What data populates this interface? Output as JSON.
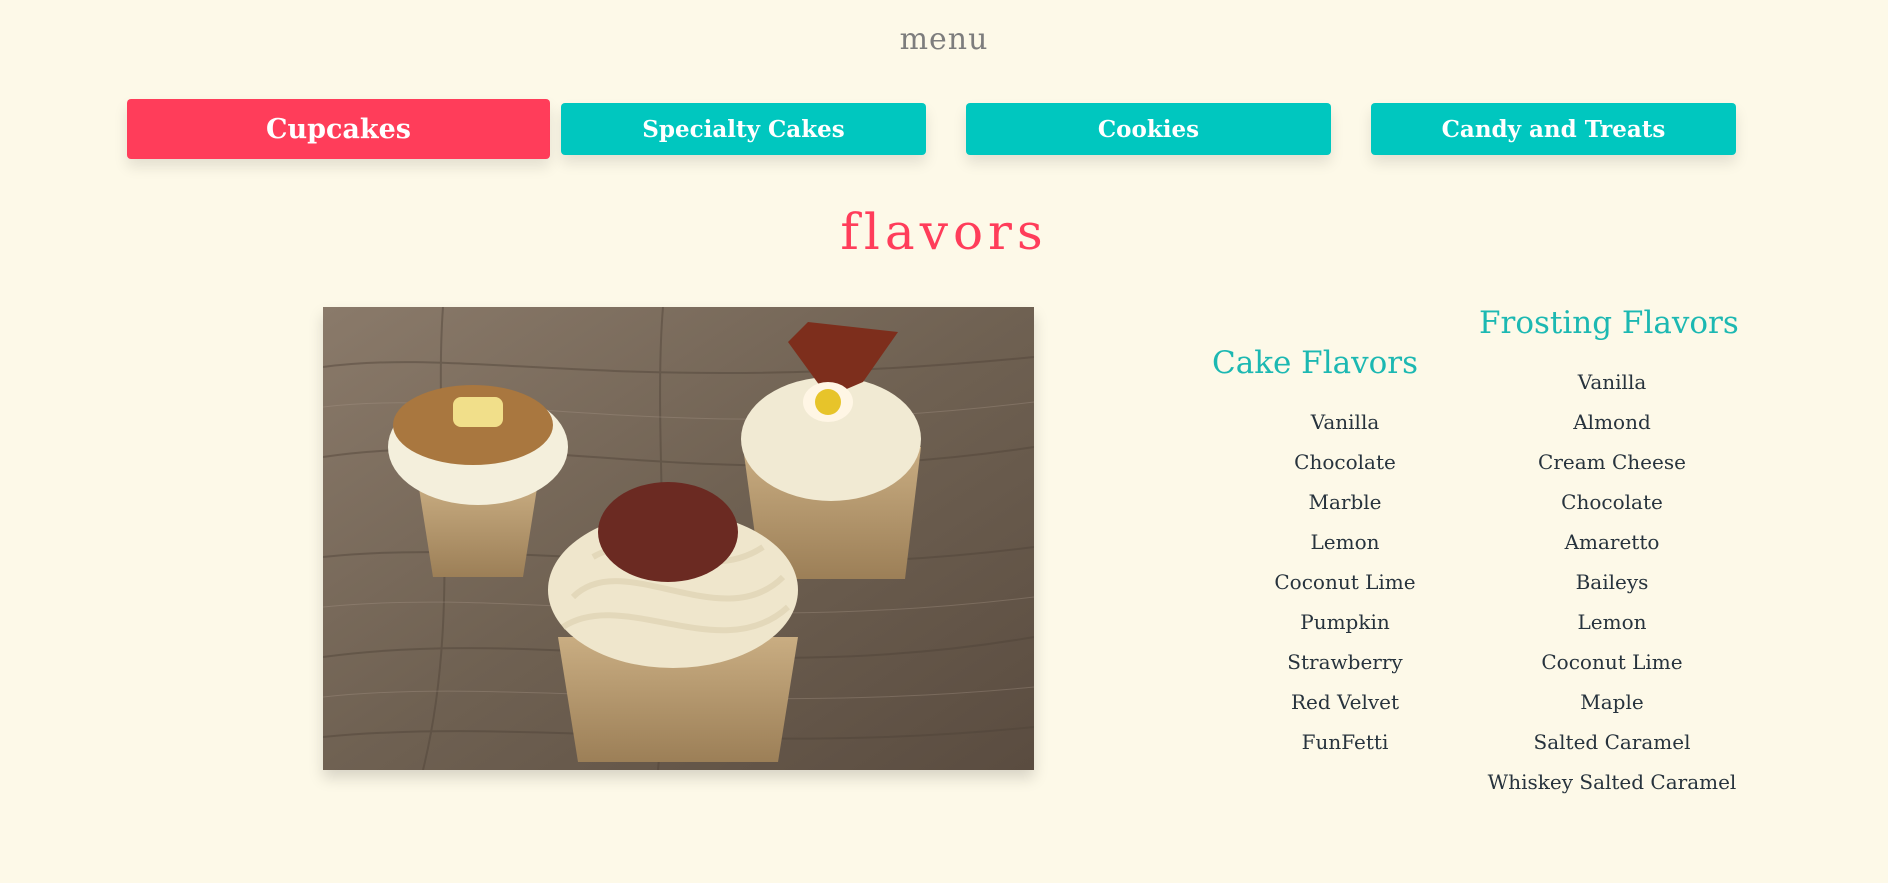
{
  "header": {
    "title": "menu"
  },
  "tabs": [
    {
      "label": "Cupcakes",
      "active": true
    },
    {
      "label": "Specialty Cakes",
      "active": false
    },
    {
      "label": "Cookies",
      "active": false
    },
    {
      "label": "Candy and Treats",
      "active": false
    }
  ],
  "section": {
    "heading": "flavors"
  },
  "cake_flavors": {
    "heading": "Cake Flavors",
    "items": [
      "Vanilla",
      "Chocolate",
      "Marble",
      "Lemon",
      "Coconut Lime",
      "Pumpkin",
      "Strawberry",
      "Red Velvet",
      "FunFetti"
    ]
  },
  "frosting_flavors": {
    "heading": "Frosting Flavors",
    "items": [
      "Vanilla",
      "Almond",
      "Cream Cheese",
      "Chocolate",
      "Amaretto",
      "Baileys",
      "Lemon",
      "Coconut Lime",
      "Maple",
      "Salted Caramel",
      "Whiskey Salted Caramel"
    ]
  },
  "colors": {
    "background": "#fdf9e8",
    "active_tab": "#ff3d5a",
    "tab": "#00c7bf",
    "heading_accent": "#ff3d5a",
    "column_heading": "#1cb8b2"
  }
}
